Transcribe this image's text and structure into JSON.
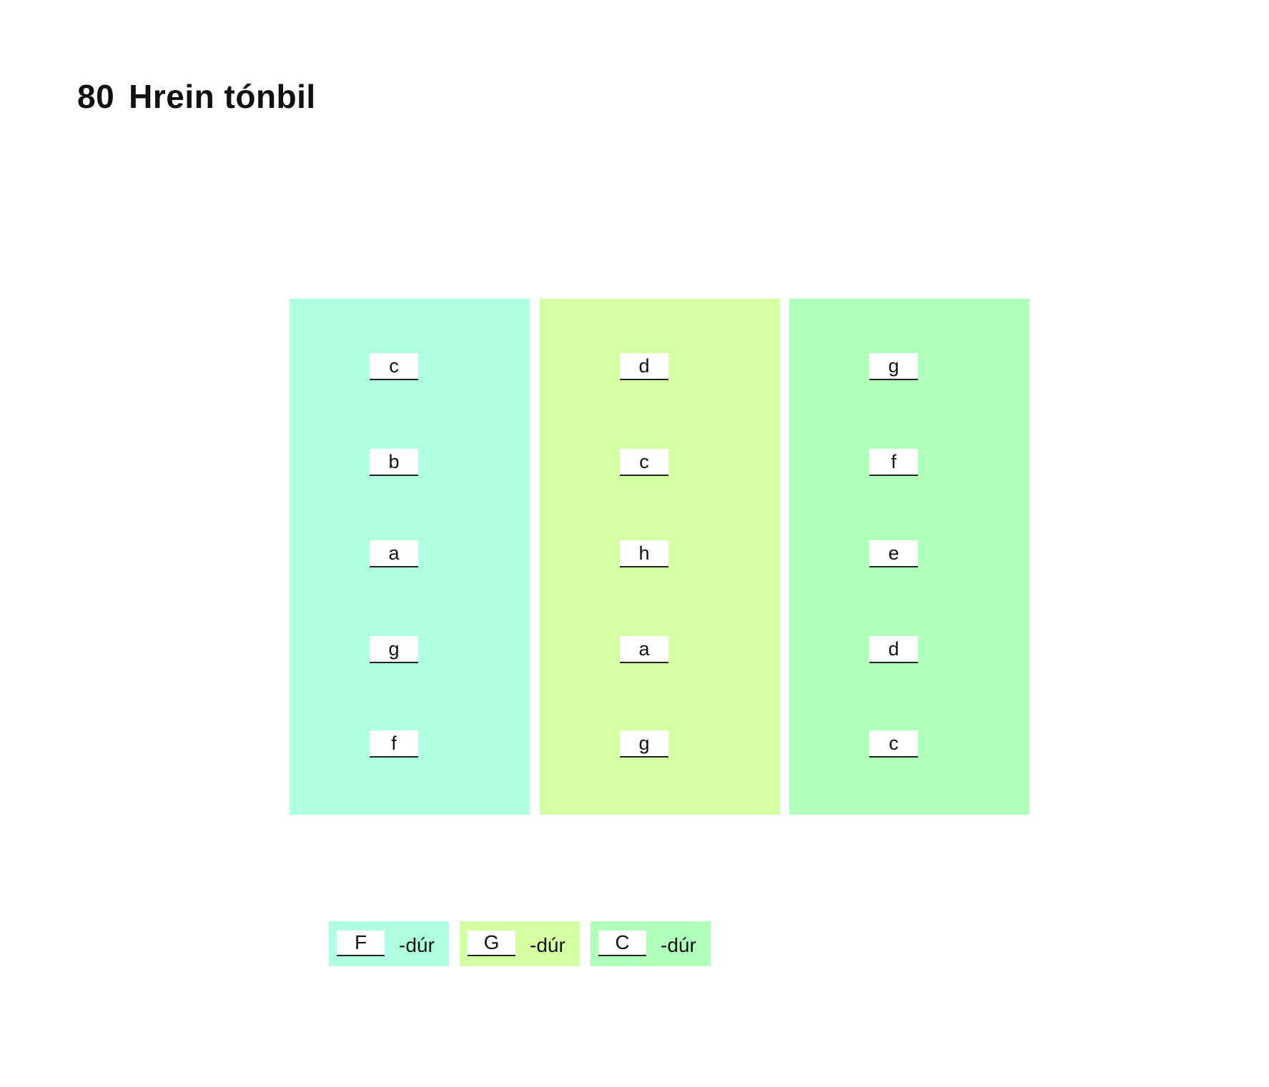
{
  "title": {
    "number": "80",
    "text": "Hrein tónbil"
  },
  "colors": {
    "col1": "#adffe0",
    "col2": "#d5ffa3",
    "col3": "#b0ffba"
  },
  "columns": [
    {
      "notes": [
        "c",
        "b",
        "a",
        "g",
        "f"
      ]
    },
    {
      "notes": [
        "d",
        "c",
        "h",
        "a",
        "g"
      ]
    },
    {
      "notes": [
        "g",
        "f",
        "e",
        "d",
        "c"
      ]
    }
  ],
  "legend": [
    {
      "key": "F",
      "suffix": "-dúr"
    },
    {
      "key": "G",
      "suffix": "-dúr"
    },
    {
      "key": "C",
      "suffix": "-dúr"
    }
  ]
}
